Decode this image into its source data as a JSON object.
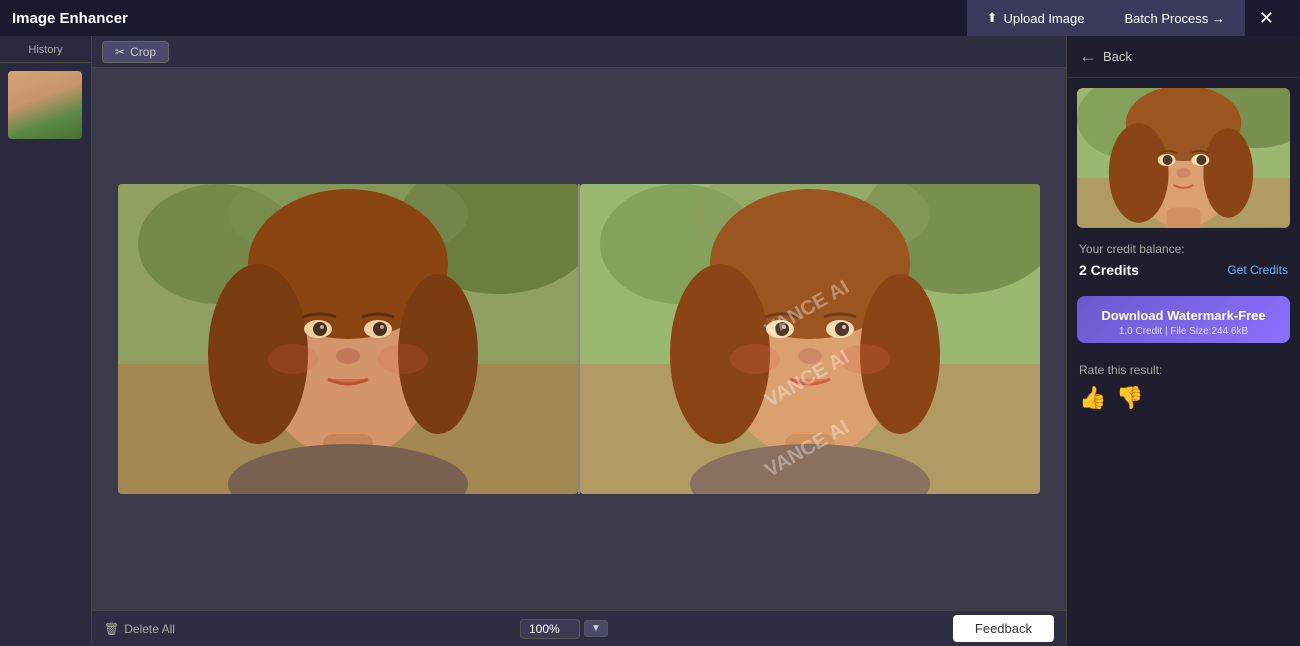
{
  "app": {
    "title": "Image Enhancer",
    "close_icon": "✕"
  },
  "header": {
    "upload_label": "Upload Image",
    "batch_label": "Batch Process →",
    "upload_icon": "⬆",
    "arrow": "→"
  },
  "sidebar": {
    "history_label": "History"
  },
  "toolbar": {
    "crop_label": "Crop",
    "crop_icon": "✂"
  },
  "bottom_bar": {
    "delete_label": "Delete All",
    "delete_icon": "🗑",
    "zoom_value": "100%",
    "feedback_label": "Feedback"
  },
  "right_panel": {
    "back_label": "Back",
    "credit_label": "Your credit balance:",
    "credit_count": "2 Credits",
    "get_credits": "Get Credits",
    "download_title": "Download Watermark-Free",
    "download_sub": "1.0 Credit | File Size:244.6kB",
    "rate_label": "Rate this result:"
  },
  "watermarks": [
    "VANCE AI",
    "VANCE AI",
    "VANCE AI"
  ]
}
